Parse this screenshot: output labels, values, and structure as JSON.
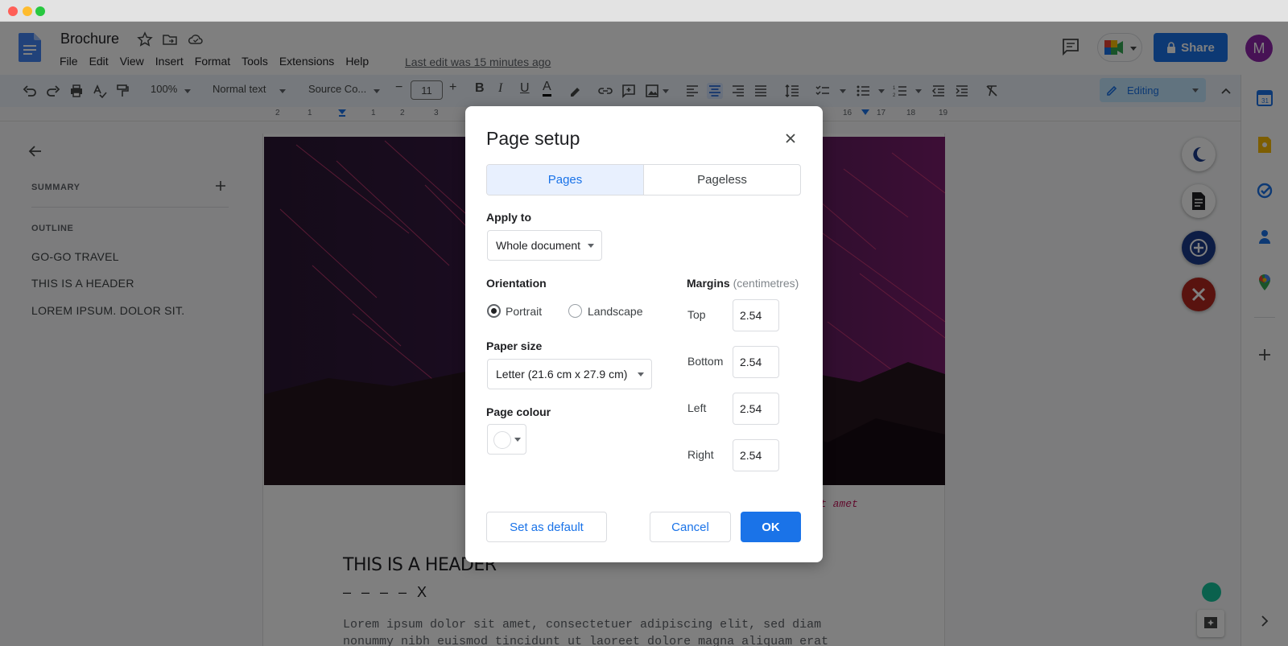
{
  "window": {
    "traffic_lights": [
      "#ff5f57",
      "#febc2e",
      "#28c840"
    ]
  },
  "header": {
    "title": "Brochure",
    "menu": [
      "File",
      "Edit",
      "View",
      "Insert",
      "Format",
      "Tools",
      "Extensions",
      "Help"
    ],
    "last_edit": "Last edit was 15 minutes ago",
    "share_label": "Share",
    "avatar_initial": "M"
  },
  "toolbar": {
    "zoom": "100%",
    "style": "Normal text",
    "font": "Source Co...",
    "font_size": "11",
    "mode": "Editing"
  },
  "ruler": {
    "left_ticks": [
      "2",
      "1",
      "1",
      "2",
      "3"
    ],
    "right_ticks": [
      "16",
      "17",
      "18",
      "19"
    ]
  },
  "outline": {
    "summary_label": "SUMMARY",
    "outline_label": "OUTLINE",
    "items": [
      "GO-GO TRAVEL",
      "THIS IS A HEADER",
      "LOREM IPSUM. DOLOR SIT."
    ]
  },
  "document": {
    "caption_fragment": "t amet",
    "header": "THIS IS A HEADER",
    "dash_line": "– – – – X",
    "body_lines": [
      "Lorem ipsum dolor sit amet, consectetuer adipiscing elit, sed diam",
      "nonummy nibh euismod tincidunt ut laoreet dolore magna aliquam erat"
    ]
  },
  "dialog": {
    "title": "Page setup",
    "tabs": [
      {
        "label": "Pages",
        "active": true
      },
      {
        "label": "Pageless",
        "active": false
      }
    ],
    "apply_to": {
      "label": "Apply to",
      "value": "Whole document"
    },
    "orientation": {
      "label": "Orientation",
      "options": [
        {
          "label": "Portrait",
          "selected": true
        },
        {
          "label": "Landscape",
          "selected": false
        }
      ]
    },
    "paper_size": {
      "label": "Paper size",
      "value": "Letter (21.6 cm x 27.9 cm)"
    },
    "page_colour": {
      "label": "Page colour",
      "value": "#ffffff"
    },
    "margins": {
      "label": "Margins",
      "unit": "(centimetres)",
      "fields": [
        {
          "label": "Top",
          "value": "2.54"
        },
        {
          "label": "Bottom",
          "value": "2.54"
        },
        {
          "label": "Left",
          "value": "2.54"
        },
        {
          "label": "Right",
          "value": "2.54"
        }
      ]
    },
    "buttons": {
      "set_default": "Set as default",
      "cancel": "Cancel",
      "ok": "OK"
    }
  },
  "colors": {
    "accent": "#1a73e8",
    "overlay": "rgba(0,0,0,0.5)"
  }
}
